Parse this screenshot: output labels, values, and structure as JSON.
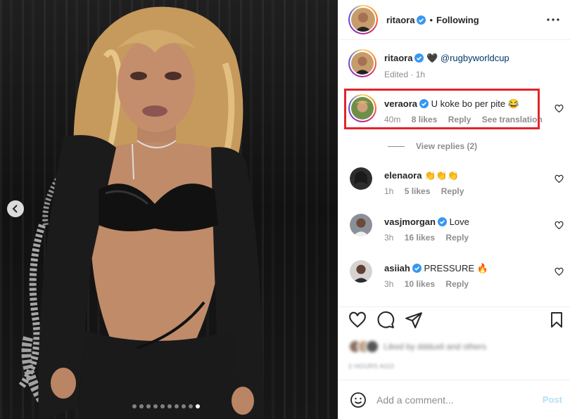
{
  "post": {
    "photo_label": "carousel photo",
    "carousel": {
      "count": 10,
      "active_index": 9
    }
  },
  "header": {
    "username": "ritaora",
    "separator": "•",
    "follow_status": "Following"
  },
  "caption": {
    "username": "ritaora",
    "emoji": "🖤",
    "mention": "@rugbyworldcup",
    "meta": "Edited · 1h"
  },
  "comments": [
    {
      "username": "veraora",
      "verified": true,
      "text": "U koke bo per pite 😂",
      "time": "40m",
      "likes": "8 likes",
      "reply": "Reply",
      "translate": "See translation"
    },
    {
      "username": "elenaora",
      "verified": false,
      "text": "👏👏👏",
      "time": "1h",
      "likes": "5 likes",
      "reply": "Reply"
    },
    {
      "username": "vasjmorgan",
      "verified": true,
      "text": "Love",
      "time": "3h",
      "likes": "16 likes",
      "reply": "Reply"
    },
    {
      "username": "asiiah",
      "verified": true,
      "text": "PRESSURE 🔥",
      "time": "3h",
      "likes": "10 likes",
      "reply": "Reply"
    }
  ],
  "view_replies": "View replies (2)",
  "likes_summary": {
    "text": "Liked by ddduxli and others",
    "time": "2 HOURS AGO"
  },
  "add_comment": {
    "placeholder": "Add a comment...",
    "post_label": "Post"
  },
  "colors": {
    "verified": "#3897f0",
    "highlight": "#e0252b",
    "link": "#00376b",
    "post_disabled": "#b2dffc"
  }
}
